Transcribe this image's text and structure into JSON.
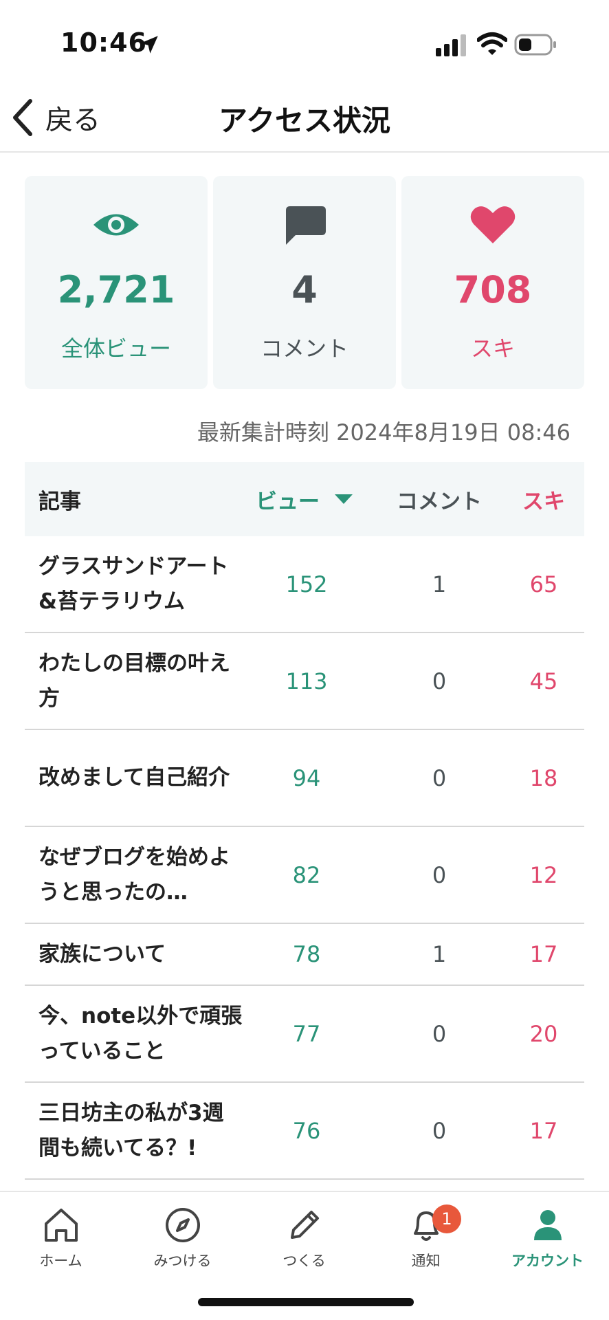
{
  "status_bar": {
    "time": "10:46"
  },
  "header": {
    "back_label": "戻る",
    "title": "アクセス状況"
  },
  "stats": [
    {
      "icon": "eye-icon",
      "value": "2,721",
      "label": "全体ビュー",
      "color": "#2a9378"
    },
    {
      "icon": "comment-icon",
      "value": "4",
      "label": "コメント",
      "color": "#4a5256"
    },
    {
      "icon": "heart-icon",
      "value": "708",
      "label": "スキ",
      "color": "#e0476c"
    }
  ],
  "updated_at": "最新集計時刻 2024年8月19日 08:46",
  "table": {
    "headers": {
      "article": "記事",
      "views": "ビュー",
      "comments": "コメント",
      "likes": "スキ"
    },
    "rows": [
      {
        "title": "グラスサンドアート&苔テラリウム",
        "views": "152",
        "comments": "1",
        "likes": "65"
      },
      {
        "title": "わたしの目標の叶え方",
        "views": "113",
        "comments": "0",
        "likes": "45"
      },
      {
        "title": "改めまして自己紹介",
        "views": "94",
        "comments": "0",
        "likes": "18"
      },
      {
        "title": "なぜブログを始めようと思ったの…",
        "views": "82",
        "comments": "0",
        "likes": "12"
      },
      {
        "title": "家族について",
        "views": "78",
        "comments": "1",
        "likes": "17"
      },
      {
        "title": "今、note以外で頑張っていること",
        "views": "77",
        "comments": "0",
        "likes": "20"
      },
      {
        "title": "三日坊主の私が3週間も続いてる？!",
        "views": "76",
        "comments": "0",
        "likes": "17"
      }
    ]
  },
  "tab_bar": {
    "tabs": [
      {
        "label": "ホーム",
        "icon": "home-icon"
      },
      {
        "label": "みつける",
        "icon": "compass-icon"
      },
      {
        "label": "つくる",
        "icon": "pencil-icon"
      },
      {
        "label": "通知",
        "icon": "bell-icon",
        "badge": "1"
      },
      {
        "label": "アカウント",
        "icon": "person-icon",
        "active": true
      }
    ]
  },
  "colors": {
    "accent_green": "#2a9378",
    "accent_pink": "#e0476c",
    "neutral": "#4a5256",
    "badge": "#e8583b"
  }
}
